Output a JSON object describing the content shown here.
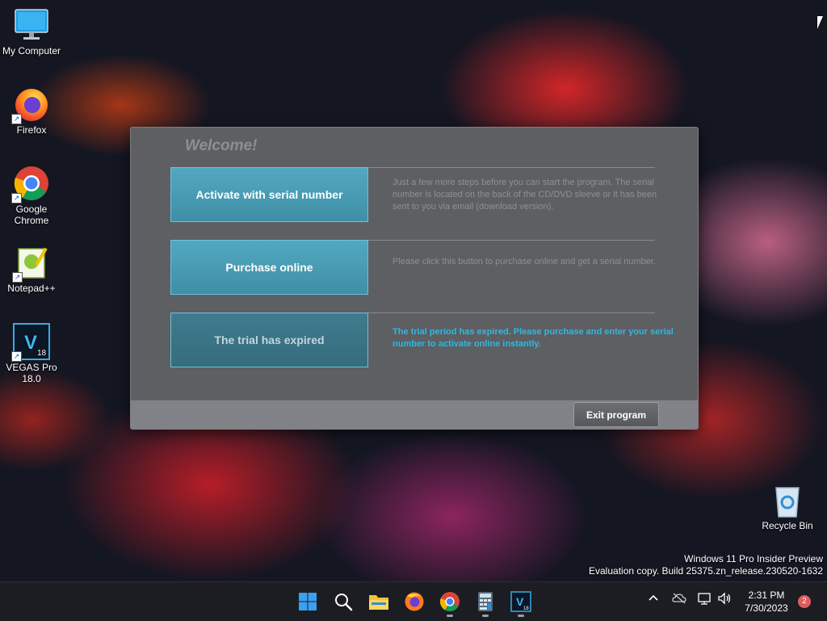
{
  "desktop": {
    "icons": [
      {
        "label": "My Computer",
        "icon": "monitor-icon"
      },
      {
        "label": "Firefox",
        "icon": "firefox-icon"
      },
      {
        "label": "Google Chrome",
        "icon": "chrome-icon"
      },
      {
        "label": "Notepad++",
        "icon": "notepadpp-icon"
      },
      {
        "label": "VEGAS Pro 18.0",
        "icon": "vegas-icon"
      },
      {
        "label": "Recycle Bin",
        "icon": "recycle-bin-icon"
      }
    ],
    "watermark_line1": "Windows 11 Pro Insider Preview",
    "watermark_line2": "Evaluation copy. Build 25375.zn_release.230520-1632"
  },
  "dialog": {
    "title": "Welcome!",
    "options": [
      {
        "label": "Activate with serial number",
        "description": "Just a few more steps before you can start the program. The serial number is located on the back of the CD/DVD sleeve or it has been sent to you via email (download version)."
      },
      {
        "label": "Purchase online",
        "description": "Please click this button to purchase online and get a serial number."
      },
      {
        "label": "The trial has expired",
        "description": "The trial period has expired. Please purchase and enter your serial number to activate online instantly."
      }
    ],
    "exit_label": "Exit program"
  },
  "taskbar": {
    "apps": [
      "start-icon",
      "search-icon",
      "file-explorer-icon",
      "firefox-icon",
      "chrome-icon",
      "calculator-icon",
      "vegas-icon"
    ],
    "time": "2:31 PM",
    "date": "7/30/2023",
    "notification_count": "2",
    "vegas_badge": "18"
  },
  "colors": {
    "accent_button": "#4a9fb8",
    "alert_text": "#2fb8e0",
    "dialog_bg": "#5d5f63"
  }
}
